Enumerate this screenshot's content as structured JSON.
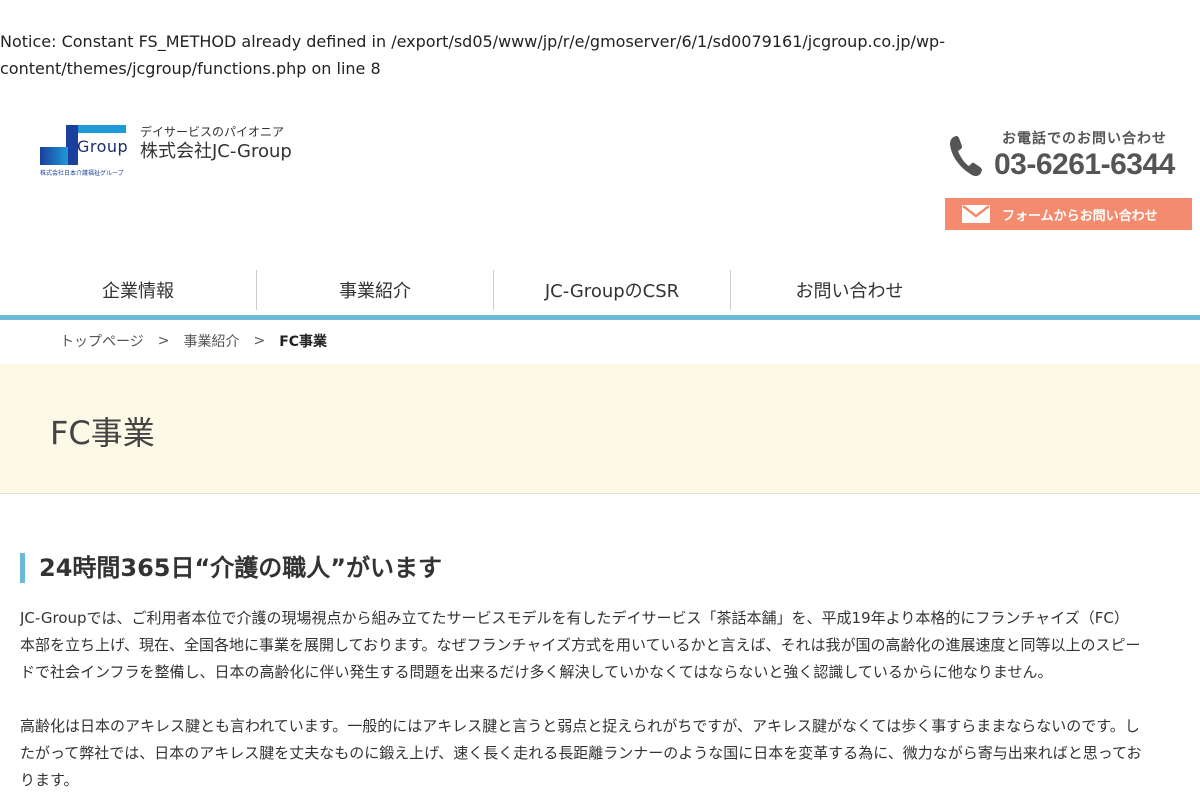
{
  "notice": {
    "line1": "Notice: Constant FS_METHOD already defined in /export/sd05/www/jp/r/e/gmoserver/6/1/sd0079161/jcgroup.co.jp/wp-",
    "line2": "content/themes/jcgroup/functions.php on line 8"
  },
  "header": {
    "logo": {
      "mark_text": "Group",
      "mark_subtext": "株式会社日本介護福祉グループ",
      "tagline": "デイサービスのパイオニア",
      "company_name": "株式会社JC-Group"
    },
    "contact": {
      "tel_label": "お電話でのお問い合わせ",
      "tel_number": "03-6261-6344",
      "form_button_label": "フォームからお問い合わせ",
      "phone_icon": "phone-icon",
      "mail_icon": "mail-icon"
    }
  },
  "nav": {
    "items": [
      {
        "label": "企業情報"
      },
      {
        "label": "事業紹介"
      },
      {
        "label": "JC-GroupのCSR"
      },
      {
        "label": "お問い合わせ"
      }
    ]
  },
  "breadcrumb": {
    "items": [
      {
        "label": "トップページ"
      },
      {
        "label": "事業紹介"
      },
      {
        "label": "FC事業"
      }
    ],
    "separator": ">"
  },
  "hero": {
    "title": "FC事業"
  },
  "content": {
    "section_title": "24時間365日“介護の職人”がいます",
    "paragraphs": [
      {
        "lines": [
          "JC-Groupでは、ご利用者本位で介護の現場視点から組み立てたサービスモデルを有したデイサービス「茶話本舗」を、平成19年より本格的にフランチャイズ（FC）",
          "本部を立ち上げ、現在、全国各地に事業を展開しております。なぜフランチャイズ方式を用いているかと言えば、それは我が国の高齢化の進展速度と同等以上のスピー",
          "ドで社会インフラを整備し、日本の高齢化に伴い発生する問題を出来るだけ多く解決していかなくてはならないと強く認識しているからに他なりません。"
        ]
      },
      {
        "lines": [
          "高齢化は日本のアキレス腱とも言われています。一般的にはアキレス腱と言うと弱点と捉えられがちですが、アキレス腱がなくては歩く事すらままならないのです。し",
          "たがって弊社では、日本のアキレス腱を丈夫なものに鍛え上げ、速く長く走れる長距離ランナーのような国に日本を変革する為に、微力ながら寄与出来ればと思ってお",
          "ります。"
        ]
      }
    ]
  },
  "colors": {
    "accent_blue": "#6bb9d6",
    "cta_orange": "#f48b6e",
    "hero_bg": "#fcf9e7",
    "logo_navy": "#1a3f9c"
  }
}
